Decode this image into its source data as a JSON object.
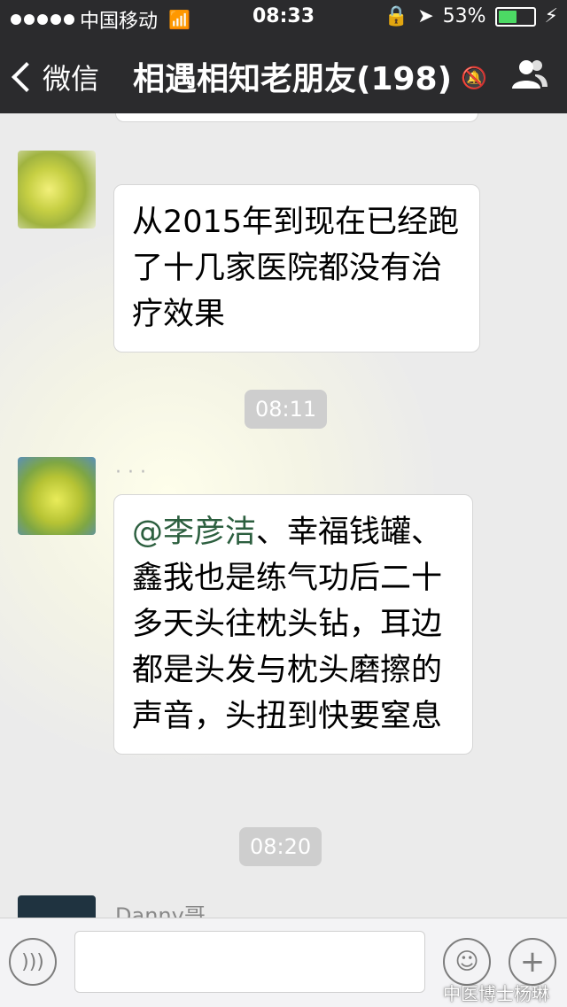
{
  "status_bar": {
    "carrier": "中国移动",
    "time": "08:33",
    "battery": "53%",
    "battery_level": 0.53
  },
  "nav": {
    "back_label": "微信",
    "title": "相遇相知老朋友(198)",
    "icons": [
      "chevron-left-icon",
      "mute-icon",
      "group-members-icon"
    ]
  },
  "chat": {
    "messages": [
      {
        "type": "text",
        "text": "从2015年到现在已经跑了十几家医院都没有治疗效果"
      },
      {
        "type": "time",
        "text": "08:11"
      },
      {
        "type": "text",
        "mention": "@李彦洁",
        "text": "、幸福钱罐、鑫我也是练气功后二十多天头往枕头钻，耳边都是头发与枕头磨擦的声音，头扭到快要窒息"
      },
      {
        "type": "time",
        "text": "08:20"
      },
      {
        "type": "sender",
        "nickname": "Danny哥"
      }
    ]
  },
  "input_bar": {
    "icons": [
      "voice-icon",
      "emoji-icon",
      "plus-icon"
    ]
  },
  "watermark": "中医博士杨琳"
}
